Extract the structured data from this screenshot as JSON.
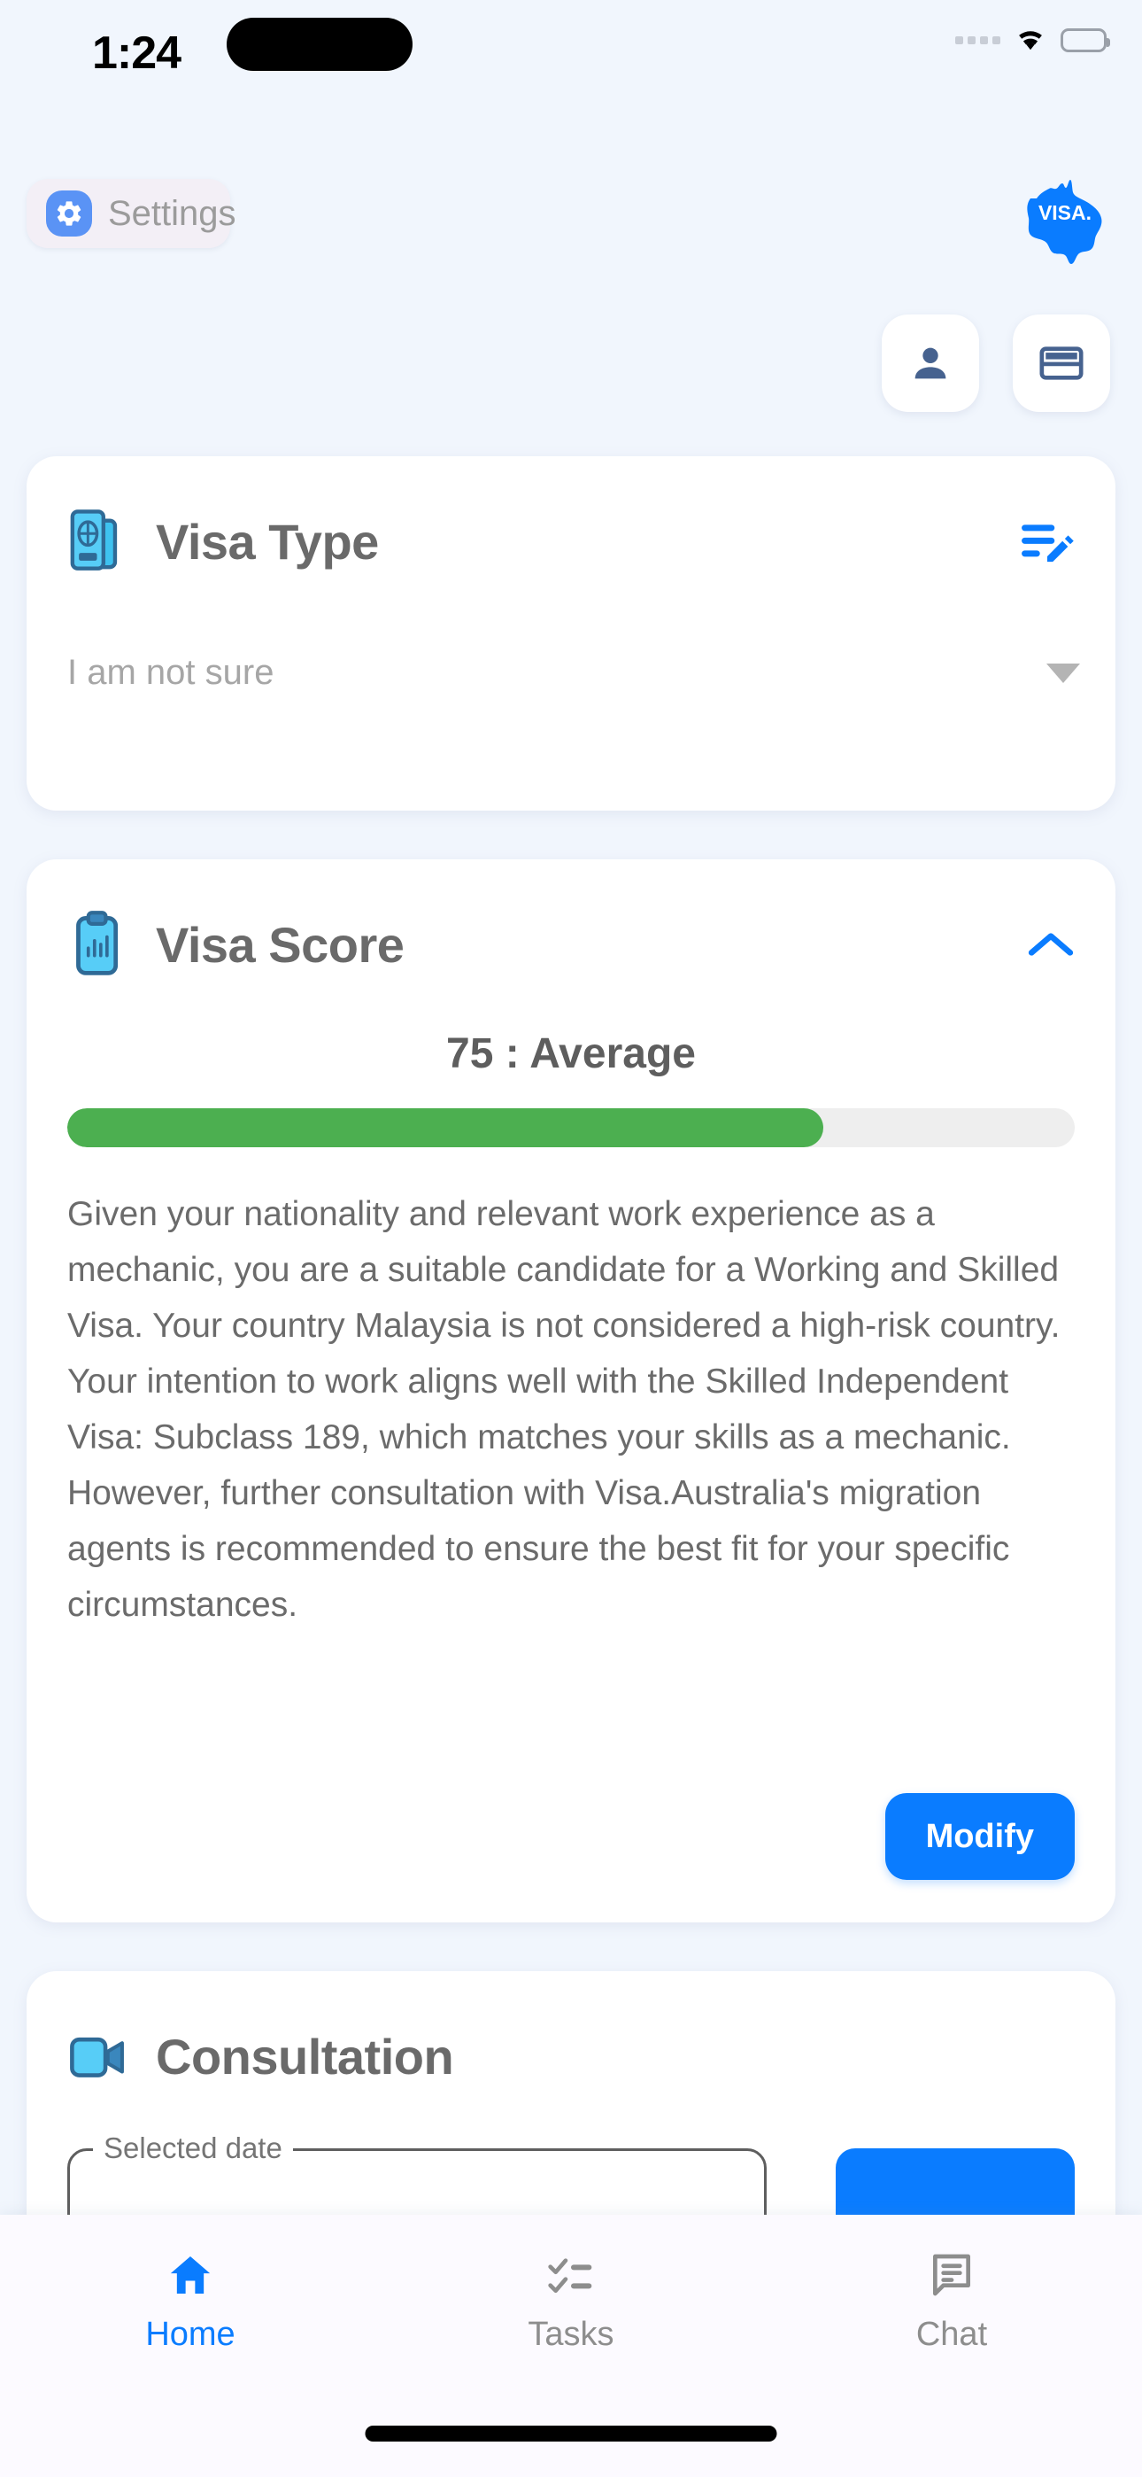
{
  "status_bar": {
    "time": "1:24",
    "signal_icon": "signal-dots-icon",
    "wifi_icon": "wifi-icon",
    "battery_icon": "battery-full-icon"
  },
  "header": {
    "settings_label": "Settings",
    "settings_icon": "gear-icon",
    "brand_logo_text": "VISA.",
    "brand_logo_icon": "australia-map-icon",
    "quick_actions": [
      {
        "name": "profile-button",
        "icon": "person-icon"
      },
      {
        "name": "payments-button",
        "icon": "credit-card-icon"
      }
    ]
  },
  "visa_type_card": {
    "title": "Visa Type",
    "icon": "passport-id-icon",
    "edit_icon": "edit-list-icon",
    "selected_value": "I am not sure",
    "dropdown_icon": "chevron-down-icon"
  },
  "visa_score_card": {
    "title": "Visa Score",
    "icon": "clipboard-chart-icon",
    "collapse_icon": "chevron-up-icon",
    "score_line": "75 : Average",
    "score_value": 75,
    "score_label": "Average",
    "progress_percent": 75,
    "progress_color": "#4caf50",
    "description": "Given your nationality and relevant work experience as a mechanic, you are a suitable candidate for a Working and Skilled Visa. Your country Malaysia is not considered a high-risk country. Your intention to work aligns well with the Skilled Independent Visa: Subclass 189, which matches your skills as a mechanic. However, further consultation with Visa.Australia's migration agents is recommended to ensure the best fit for your specific circumstances.",
    "modify_label": "Modify"
  },
  "consultation_card": {
    "title": "Consultation",
    "icon": "video-camera-icon",
    "date_legend": "Selected date",
    "date_value": ""
  },
  "bottom_nav": {
    "items": [
      {
        "label": "Home",
        "icon": "home-icon",
        "active": true
      },
      {
        "label": "Tasks",
        "icon": "checklist-icon",
        "active": false
      },
      {
        "label": "Chat",
        "icon": "chat-icon",
        "active": false
      }
    ]
  },
  "colors": {
    "background": "#f1f6fd",
    "accent": "#0a7cff",
    "card": "#ffffff",
    "progress_green": "#4caf50",
    "title_grey": "#6a6a6a"
  }
}
